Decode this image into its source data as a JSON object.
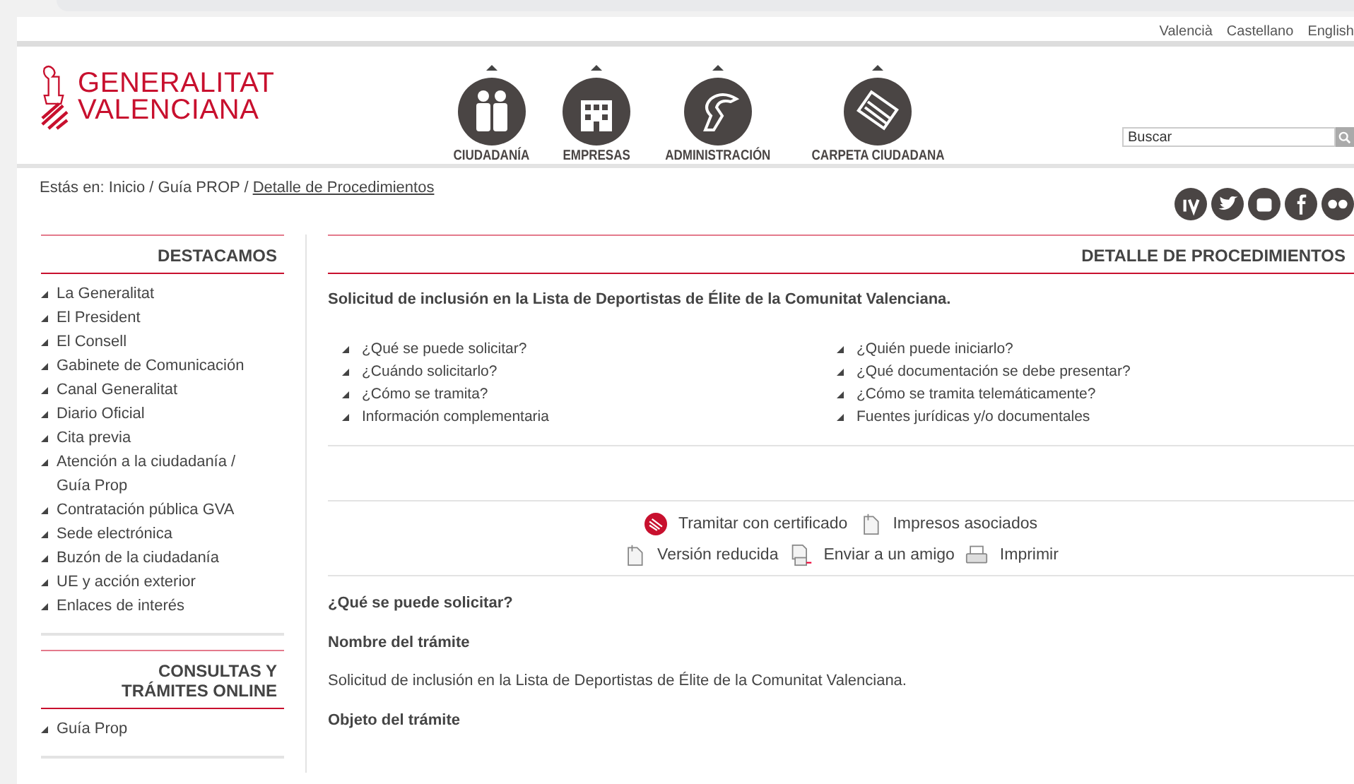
{
  "languages": [
    "Valencià",
    "Castellano",
    "English"
  ],
  "logo": {
    "line1": "GENERALITAT",
    "line2": "VALENCIANA"
  },
  "nav": [
    {
      "label": "CIUDADANÍA",
      "kind": "people"
    },
    {
      "label": "EMPRESAS",
      "kind": "building"
    },
    {
      "label": "ADMINISTRACIÓN",
      "kind": "bat"
    },
    {
      "label": "CARPETA CIUDADANA",
      "kind": "card"
    }
  ],
  "search": {
    "placeholder": "Buscar"
  },
  "breadcrumb": {
    "prefix": "Estás en: Inicio / Guía PROP / ",
    "current": "Detalle de Procedimientos"
  },
  "social": [
    {
      "kind": "iv"
    },
    {
      "kind": "twitter"
    },
    {
      "kind": "youtube"
    },
    {
      "kind": "facebook"
    },
    {
      "kind": "flickr"
    }
  ],
  "sidebar": [
    {
      "title": "DESTACAMOS",
      "items": [
        "La Generalitat",
        "El President",
        "El Consell",
        "Gabinete de Comunicación",
        "Canal Generalitat",
        "Diario Oficial",
        "Cita previa",
        "Atención a la ciudadanía / Guía Prop",
        "Contratación pública GVA",
        "Sede electrónica",
        "Buzón de la ciudadanía",
        "UE y acción exterior",
        "Enlaces de interés"
      ]
    },
    {
      "title": "CONSULTAS Y TRÁMITES ONLINE",
      "items": [
        "Guía Prop"
      ]
    }
  ],
  "content": {
    "heading": "DETALLE DE PROCEDIMIENTOS",
    "title": "Solicitud de inclusión en la Lista de Deportistas de Élite de la Comunitat Valenciana.",
    "links_left": [
      "¿Qué se puede solicitar?",
      "¿Cuándo solicitarlo?",
      "¿Cómo se tramita?",
      "Información complementaria"
    ],
    "links_right": [
      "¿Quién puede iniciarlo?",
      "¿Qué documentación se debe presentar?",
      "¿Cómo se tramita telemáticamente?",
      "Fuentes jurídicas y/o documentales"
    ],
    "actions": [
      [
        {
          "label": "Tramitar con certificado",
          "kind": "cert"
        },
        {
          "label": "Impresos asociados",
          "kind": "doc"
        }
      ],
      [
        {
          "label": "Versión reducida",
          "kind": "doc"
        },
        {
          "label": "Enviar a un amigo",
          "kind": "mail"
        },
        {
          "label": "Imprimir",
          "kind": "print"
        }
      ]
    ],
    "section": "¿Qué se puede solicitar?",
    "blocks": [
      {
        "heading": "Nombre del trámite",
        "text": "Solicitud de inclusión en la Lista de Deportistas de Élite de la Comunitat Valenciana."
      },
      {
        "heading": "Objeto del trámite"
      }
    ]
  }
}
